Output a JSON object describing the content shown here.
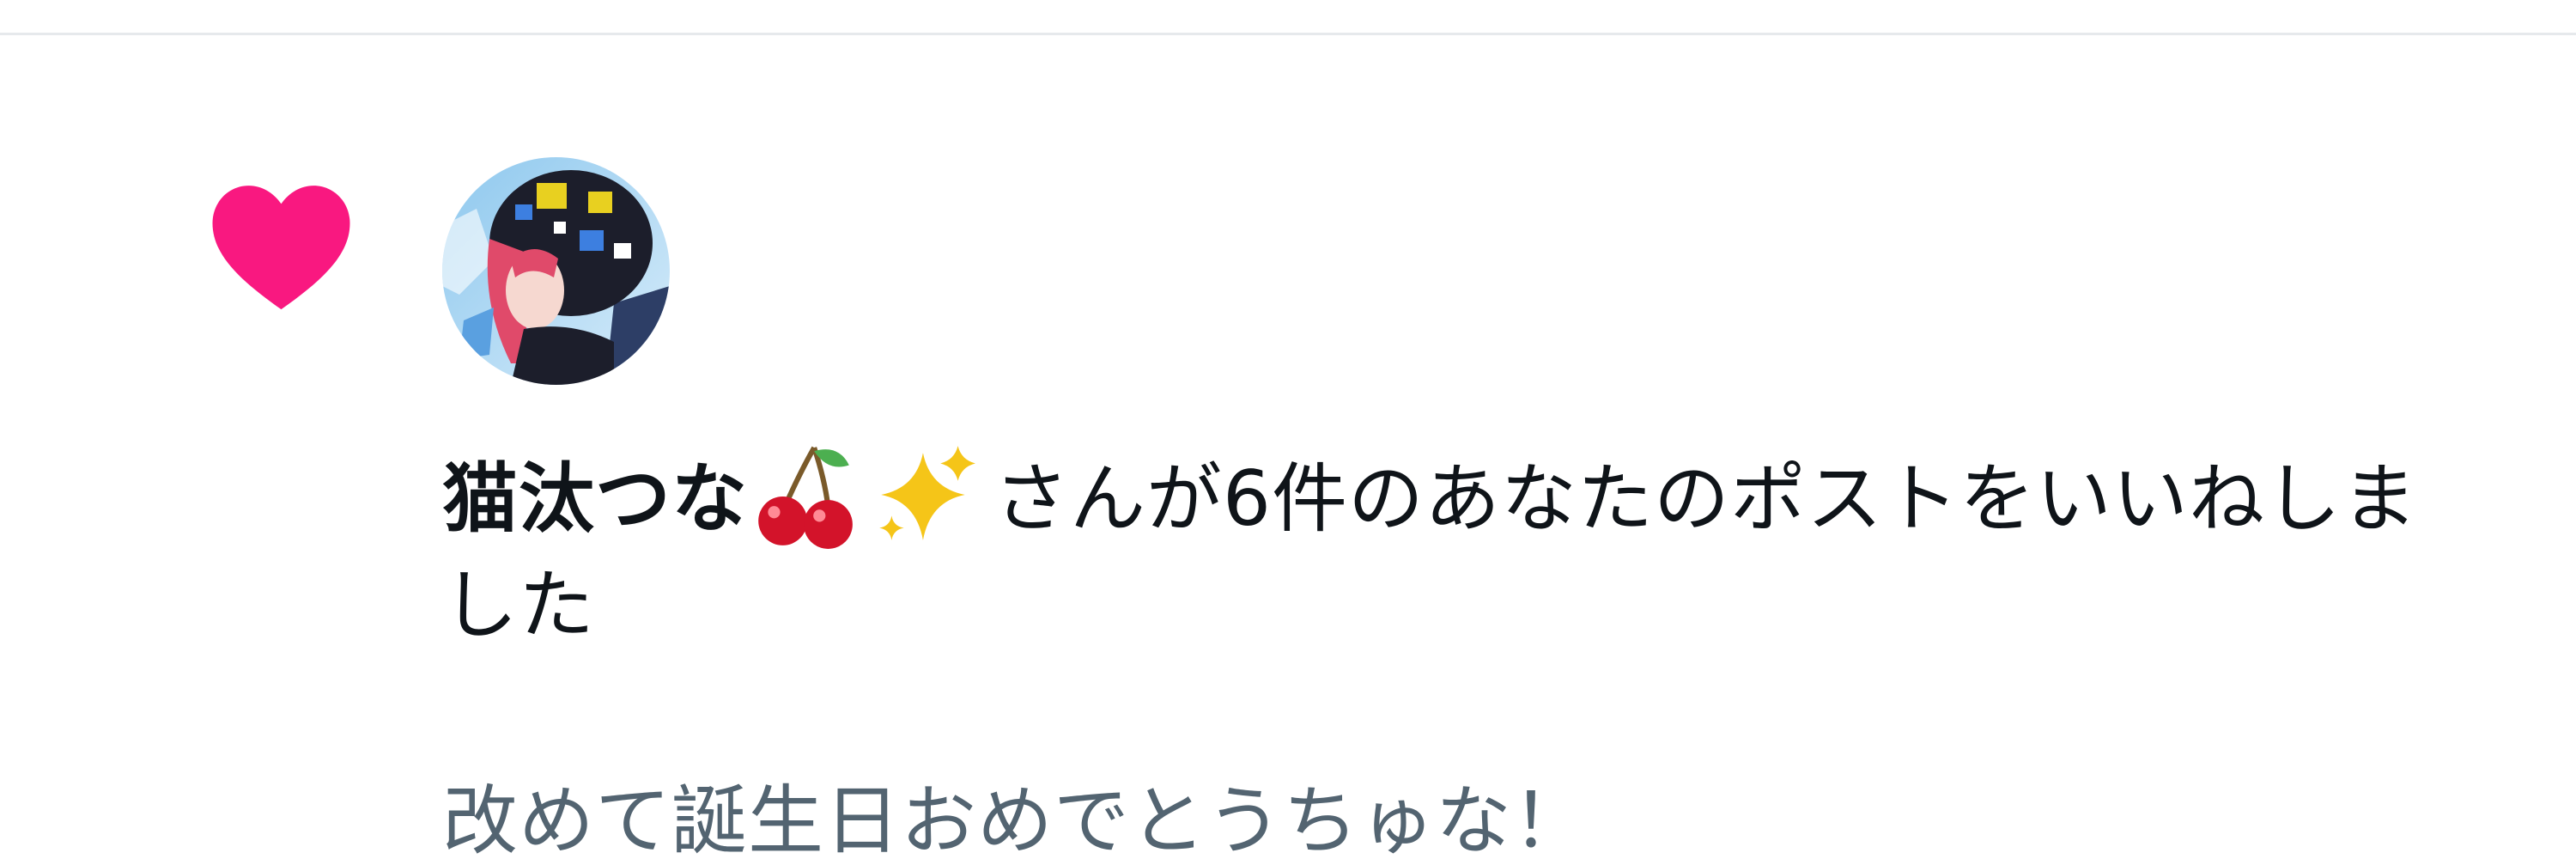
{
  "notification": {
    "type_icon": "heart-icon",
    "accent_color": "#f91880",
    "avatar_icon": "user-avatar",
    "user_name": "猫汰つな",
    "name_emojis": [
      "cherries-icon",
      "sparkles-icon"
    ],
    "message_text": "さんが6件のあなたのポストをいいねしました",
    "post_preview": "改めて誕生日おめでとうちゅな！",
    "preview_color": "#536471",
    "text_color": "#0f1419"
  }
}
